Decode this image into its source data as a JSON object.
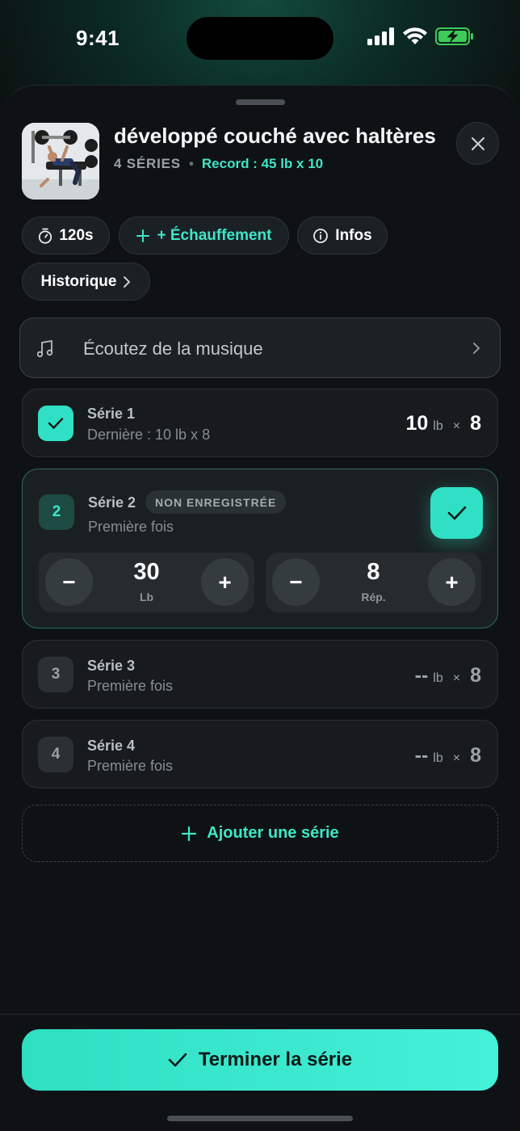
{
  "status_bar": {
    "time": "9:41"
  },
  "exercise": {
    "title": "développé couché avec haltères",
    "series_count": "4 SÉRIES",
    "separator": "•",
    "record": "Record : 45 lb x 10"
  },
  "chips": {
    "rest": "120s",
    "warmup": "+ Échauffement",
    "info": "Infos",
    "history": "Historique"
  },
  "music": {
    "label": "Écoutez de la musique"
  },
  "sets": [
    {
      "number": "1",
      "title": "Série 1",
      "sub": "Dernière : 10 lb x 8",
      "weight": "10",
      "unit": "lb",
      "times": "×",
      "reps": "8",
      "done": true
    },
    {
      "number": "2",
      "title": "Série 2",
      "tag": "NON ENREGISTRÉE",
      "sub": "Première fois",
      "weight": "30",
      "weight_unit": "Lb",
      "reps": "8",
      "reps_unit": "Rép.",
      "active": true
    },
    {
      "number": "3",
      "title": "Série 3",
      "sub": "Première fois",
      "weight": "--",
      "unit": "lb",
      "times": "×",
      "reps": "8"
    },
    {
      "number": "4",
      "title": "Série 4",
      "sub": "Première fois",
      "weight": "--",
      "unit": "lb",
      "times": "×",
      "reps": "8"
    }
  ],
  "stepper_symbols": {
    "minus": "−",
    "plus": "+"
  },
  "add_set": {
    "label": "Ajouter une série"
  },
  "finish": {
    "label": "Terminer la série"
  },
  "colors": {
    "accent": "#3ee6c8",
    "accent_button": "#2fe0c4",
    "background": "#0f1214",
    "card": "#171b1e"
  }
}
